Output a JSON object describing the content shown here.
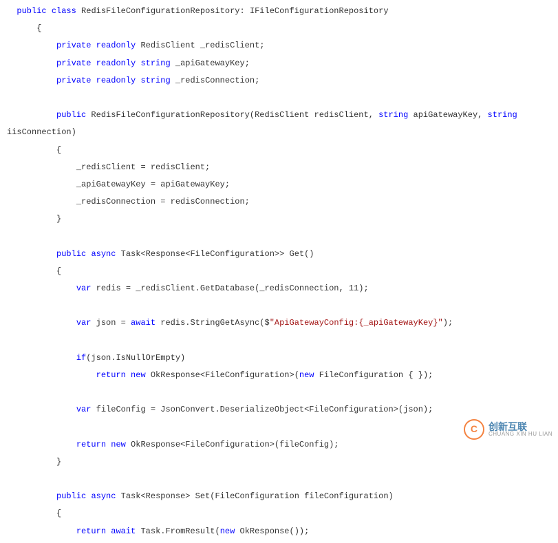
{
  "code": [
    {
      "indent": 0,
      "tokens": [
        [
          "k",
          "public"
        ],
        [
          "t",
          " "
        ],
        [
          "k",
          "class"
        ],
        [
          "t",
          " RedisFileConfigurationRepository: IFileConfigurationRepository"
        ]
      ]
    },
    {
      "indent": 1,
      "tokens": [
        [
          "t",
          "{"
        ]
      ]
    },
    {
      "indent": 2,
      "tokens": [
        [
          "k",
          "private"
        ],
        [
          "t",
          " "
        ],
        [
          "k",
          "readonly"
        ],
        [
          "t",
          " RedisClient _redisClient;"
        ]
      ]
    },
    {
      "indent": 2,
      "tokens": [
        [
          "k",
          "private"
        ],
        [
          "t",
          " "
        ],
        [
          "k",
          "readonly"
        ],
        [
          "t",
          " "
        ],
        [
          "k",
          "string"
        ],
        [
          "t",
          " _apiGatewayKey;"
        ]
      ]
    },
    {
      "indent": 2,
      "tokens": [
        [
          "k",
          "private"
        ],
        [
          "t",
          " "
        ],
        [
          "k",
          "readonly"
        ],
        [
          "t",
          " "
        ],
        [
          "k",
          "string"
        ],
        [
          "t",
          " _redisConnection;"
        ]
      ]
    },
    {
      "blank": true
    },
    {
      "indent": 2,
      "tokens": [
        [
          "k",
          "public"
        ],
        [
          "t",
          " RedisFileConfigurationRepository(RedisClient redisClient, "
        ],
        [
          "k",
          "string"
        ],
        [
          "t",
          " apiGatewayKey, "
        ],
        [
          "k",
          "string"
        ]
      ]
    },
    {
      "indent": 0,
      "noindent": true,
      "tokens": [
        [
          "t",
          "iisConnection)"
        ]
      ]
    },
    {
      "indent": 2,
      "tokens": [
        [
          "t",
          "{"
        ]
      ]
    },
    {
      "indent": 3,
      "tokens": [
        [
          "t",
          "_redisClient = redisClient;"
        ]
      ]
    },
    {
      "indent": 3,
      "tokens": [
        [
          "t",
          "_apiGatewayKey = apiGatewayKey;"
        ]
      ]
    },
    {
      "indent": 3,
      "tokens": [
        [
          "t",
          "_redisConnection = redisConnection;"
        ]
      ]
    },
    {
      "indent": 2,
      "tokens": [
        [
          "t",
          "}"
        ]
      ]
    },
    {
      "blank": true
    },
    {
      "indent": 2,
      "tokens": [
        [
          "k",
          "public"
        ],
        [
          "t",
          " "
        ],
        [
          "k",
          "async"
        ],
        [
          "t",
          " Task<Response<FileConfiguration>> Get()"
        ]
      ]
    },
    {
      "indent": 2,
      "tokens": [
        [
          "t",
          "{"
        ]
      ]
    },
    {
      "indent": 3,
      "tokens": [
        [
          "k",
          "var"
        ],
        [
          "t",
          " redis = _redisClient.GetDatabase(_redisConnection, 11);"
        ]
      ]
    },
    {
      "blank": true
    },
    {
      "indent": 3,
      "tokens": [
        [
          "k",
          "var"
        ],
        [
          "t",
          " json = "
        ],
        [
          "k",
          "await"
        ],
        [
          "t",
          " redis.StringGetAsync($"
        ],
        [
          "s",
          "\"ApiGatewayConfig:{_apiGatewayKey}\""
        ],
        [
          "t",
          ");"
        ]
      ]
    },
    {
      "blank": true
    },
    {
      "indent": 3,
      "tokens": [
        [
          "k",
          "if"
        ],
        [
          "t",
          "(json.IsNullOrEmpty)"
        ]
      ]
    },
    {
      "indent": 4,
      "tokens": [
        [
          "k",
          "return"
        ],
        [
          "t",
          " "
        ],
        [
          "k",
          "new"
        ],
        [
          "t",
          " OkResponse<FileConfiguration>("
        ],
        [
          "k",
          "new"
        ],
        [
          "t",
          " FileConfiguration { });"
        ]
      ]
    },
    {
      "blank": true
    },
    {
      "indent": 3,
      "tokens": [
        [
          "k",
          "var"
        ],
        [
          "t",
          " fileConfig = JsonConvert.DeserializeObject<FileConfiguration>(json);"
        ]
      ]
    },
    {
      "blank": true
    },
    {
      "indent": 3,
      "tokens": [
        [
          "k",
          "return"
        ],
        [
          "t",
          " "
        ],
        [
          "k",
          "new"
        ],
        [
          "t",
          " OkResponse<FileConfiguration>(fileConfig);"
        ]
      ]
    },
    {
      "indent": 2,
      "tokens": [
        [
          "t",
          "}"
        ]
      ]
    },
    {
      "blank": true
    },
    {
      "indent": 2,
      "tokens": [
        [
          "k",
          "public"
        ],
        [
          "t",
          " "
        ],
        [
          "k",
          "async"
        ],
        [
          "t",
          " Task<Response> Set(FileConfiguration fileConfiguration)"
        ]
      ]
    },
    {
      "indent": 2,
      "tokens": [
        [
          "t",
          "{"
        ]
      ]
    },
    {
      "indent": 3,
      "tokens": [
        [
          "k",
          "return"
        ],
        [
          "t",
          " "
        ],
        [
          "k",
          "await"
        ],
        [
          "t",
          " Task.FromResult("
        ],
        [
          "k",
          "new"
        ],
        [
          "t",
          " OkResponse());"
        ]
      ]
    }
  ],
  "indentUnit": "    ",
  "baseIndent": "  ",
  "watermark": {
    "icon": "C",
    "line1": "创新互联",
    "line2": "CHUANG XIN HU LIAN"
  }
}
